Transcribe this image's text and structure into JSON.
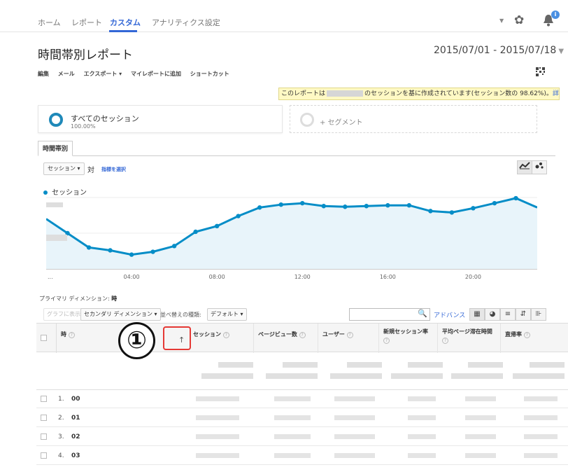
{
  "nav": {
    "tabs": [
      "ホーム",
      "レポート",
      "カスタム",
      "アナリティクス設定"
    ],
    "active_tab": "カスタム",
    "badge": "i"
  },
  "report": {
    "title": "時間帯別レポート",
    "date_range": "2015/07/01 - 2015/07/18"
  },
  "actions": [
    "編集",
    "メール",
    "エクスポート ▾",
    "マイレポートに追加",
    "ショートカット"
  ],
  "notice": {
    "prefix": "このレポートは",
    "suffix": "のセッションを基に作成されています(セッション数の 98.62%)。",
    "link": "詳細"
  },
  "segments": {
    "all_label": "すべてのセッション",
    "all_pct": "100.00%",
    "add_label": "+ セグメント"
  },
  "subtab": "時間帯別",
  "chart_controls": {
    "metric": "セッション ▾",
    "vs": "対",
    "pick_metric": "指標を選択"
  },
  "chart_data": {
    "type": "line",
    "series": [
      {
        "name": "セッション",
        "values": [
          0.3,
          0.5,
          0.7,
          0.74,
          0.8,
          0.76,
          0.68,
          0.48,
          0.4,
          0.26,
          0.14,
          0.1,
          0.08,
          0.12,
          0.13,
          0.12,
          0.11,
          0.11,
          0.19,
          0.21,
          0.15,
          0.08,
          0.01,
          0.14
        ]
      }
    ],
    "x": [
      "00",
      "01",
      "02",
      "03",
      "04",
      "05",
      "06",
      "07",
      "08",
      "09",
      "10",
      "11",
      "12",
      "13",
      "14",
      "15",
      "16",
      "17",
      "18",
      "19",
      "20",
      "21",
      "22",
      "23"
    ],
    "x_tick_labels": [
      "...",
      "04:00",
      "08:00",
      "12:00",
      "16:00",
      "20:00"
    ],
    "color": "#058dc7",
    "fill": "#e8f4fa",
    "grid": true,
    "legend": "top-left"
  },
  "primary_dimension": {
    "label": "プライマリ ディメンション:",
    "value": "時"
  },
  "table_toolbar": {
    "plot_rows": "グラフに表示",
    "secondary_dimension": "セカンダリ ディメンション ▾",
    "sort_type_label": "並べ替えの種類:",
    "sort_type": "デフォルト ▾",
    "advanced": "アドバンス"
  },
  "table": {
    "columns": [
      "時",
      "セッション",
      "ページビュー数",
      "ユーザー",
      "新規セッション率",
      "平均ページ滞在時間",
      "直帰率"
    ],
    "sort_arrow": "↑",
    "rows": [
      {
        "index": "1.",
        "hour": "00"
      },
      {
        "index": "2.",
        "hour": "01"
      },
      {
        "index": "3.",
        "hour": "02"
      },
      {
        "index": "4.",
        "hour": "03"
      }
    ]
  },
  "annotation": {
    "label": "①",
    "color": "#e53935"
  }
}
